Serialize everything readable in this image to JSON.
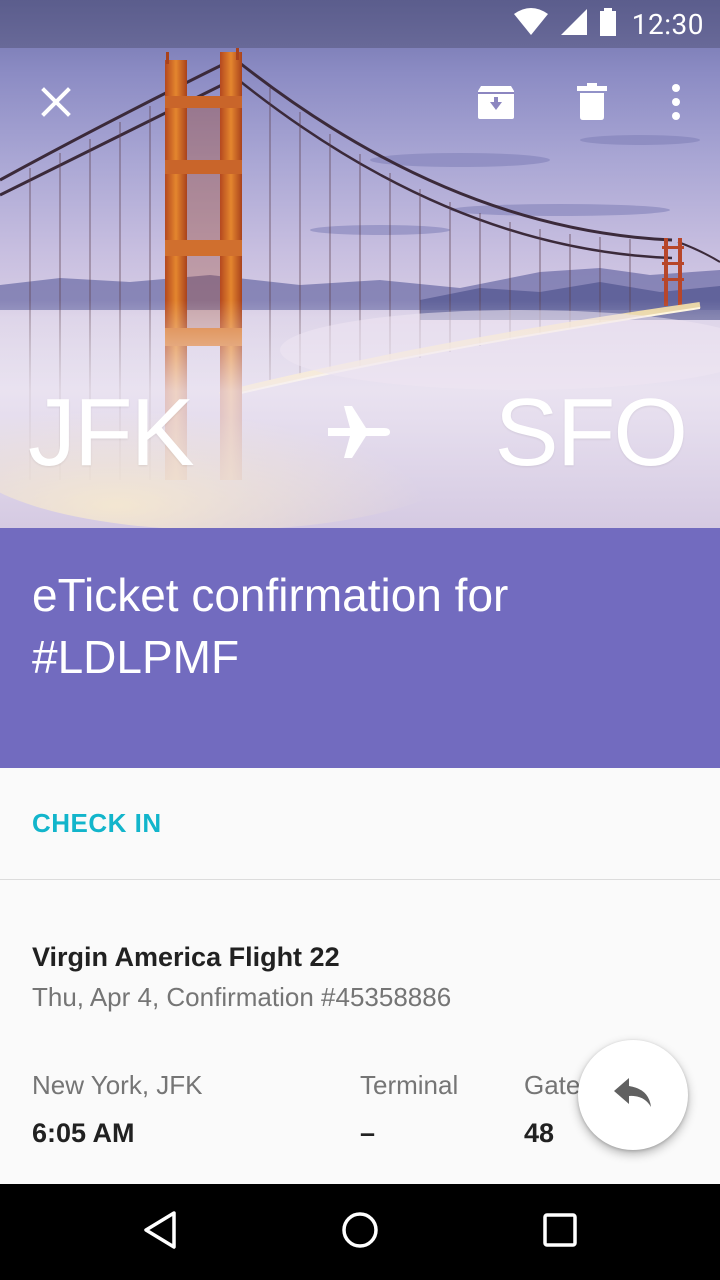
{
  "status_bar": {
    "time": "12:30",
    "icons": [
      "wifi-icon",
      "cellular-signal-icon",
      "battery-icon"
    ]
  },
  "toolbar": {
    "icons": [
      "close-icon",
      "archive-icon",
      "delete-icon",
      "more-vert-icon"
    ]
  },
  "hero": {
    "from": "JFK",
    "to": "SFO",
    "separator_icon": "airplane-icon",
    "image": "golden-gate-bridge-in-fog"
  },
  "email": {
    "subject": "eTicket confirmation for #LDLPMF"
  },
  "card": {
    "action_label": "CHECK IN",
    "flight_name": "Virgin America Flight 22",
    "flight_details": "Thu, Apr 4, Confirmation #45358886",
    "departure_label": "New York, JFK",
    "departure_time": "6:05 AM",
    "terminal_label": "Terminal",
    "terminal_value": "–",
    "gate_label": "Gate",
    "gate_value": "48"
  },
  "fab": {
    "icon": "reply-icon"
  },
  "nav_bar": {
    "icons": [
      "back-icon",
      "home-icon",
      "recents-icon"
    ]
  },
  "colors": {
    "title_band": "#726bbf",
    "accent": "#12b5cb",
    "primary_text": "#212121",
    "secondary_text": "#757575"
  }
}
